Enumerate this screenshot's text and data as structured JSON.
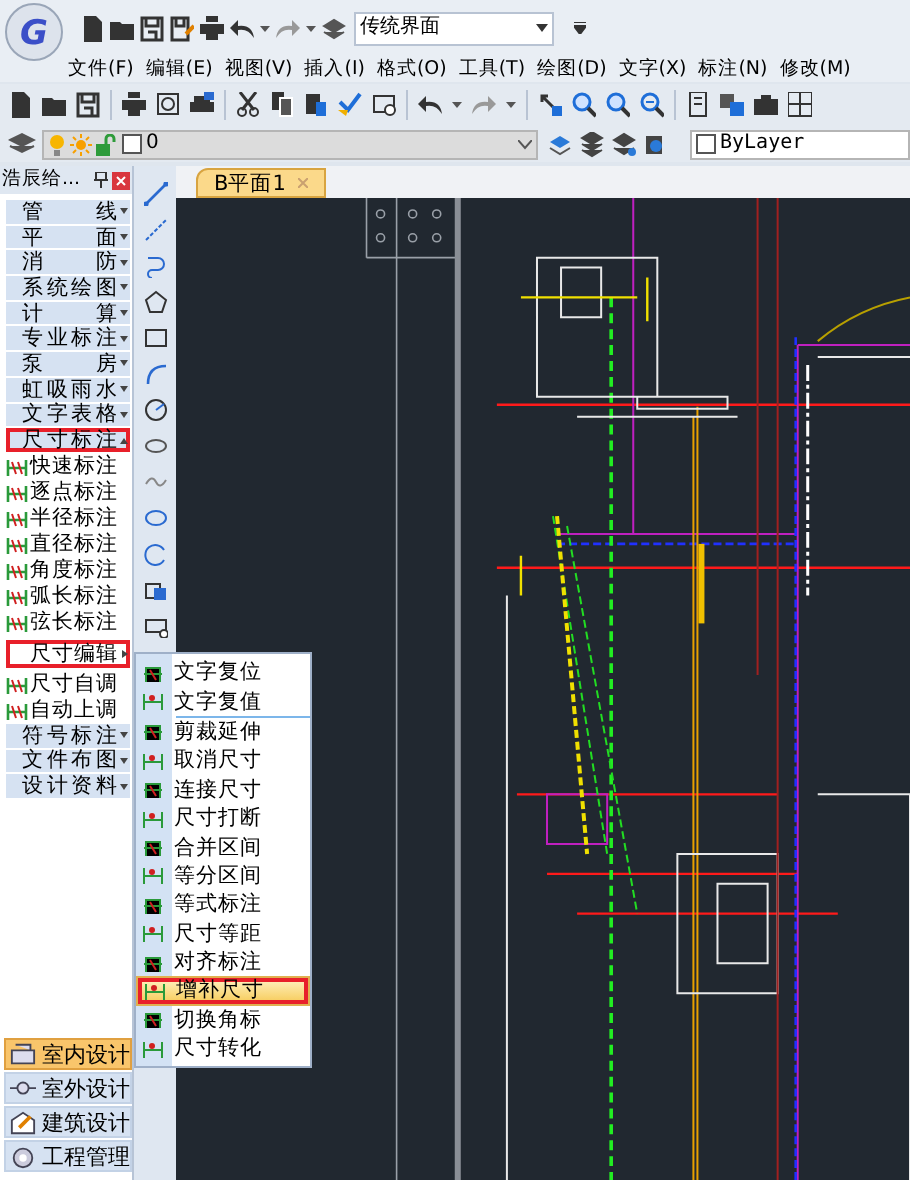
{
  "app": {
    "logo": "G"
  },
  "quick_access": {
    "workspace_dropdown": "传统界面"
  },
  "menu": [
    "文件(F)",
    "编辑(E)",
    "视图(V)",
    "插入(I)",
    "格式(O)",
    "工具(T)",
    "绘图(D)",
    "文字(X)",
    "标注(N)",
    "修改(M)"
  ],
  "layer_bar": {
    "layer": "0",
    "linetype": "ByLayer"
  },
  "panel": {
    "title": "浩辰给...",
    "items": [
      {
        "kind": "category",
        "label": "管 线",
        "expanded": false,
        "marked": false
      },
      {
        "kind": "category",
        "label": "平 面",
        "expanded": false,
        "marked": false
      },
      {
        "kind": "category",
        "label": "消 防",
        "expanded": false,
        "marked": false
      },
      {
        "kind": "category",
        "label": "系统绘图",
        "expanded": false,
        "marked": false
      },
      {
        "kind": "category",
        "label": "计 算",
        "expanded": false,
        "marked": false
      },
      {
        "kind": "category",
        "label": "专业标注",
        "expanded": false,
        "marked": false
      },
      {
        "kind": "category",
        "label": "泵 房",
        "expanded": false,
        "marked": false
      },
      {
        "kind": "category",
        "label": "虹吸雨水",
        "expanded": false,
        "marked": false
      },
      {
        "kind": "category",
        "label": "文字表格",
        "expanded": false,
        "marked": false
      },
      {
        "kind": "category",
        "label": "尺寸标注",
        "expanded": true,
        "marked": true
      },
      {
        "kind": "tool",
        "label": "快速标注",
        "marked": false
      },
      {
        "kind": "tool",
        "label": "逐点标注",
        "marked": false
      },
      {
        "kind": "tool",
        "label": "半径标注",
        "marked": false
      },
      {
        "kind": "tool",
        "label": "直径标注",
        "marked": false
      },
      {
        "kind": "tool",
        "label": "角度标注",
        "marked": false
      },
      {
        "kind": "tool",
        "label": "弧长标注",
        "marked": false
      },
      {
        "kind": "tool",
        "label": "弦长标注",
        "marked": false
      },
      {
        "kind": "flyout",
        "label": "尺寸编辑",
        "marked": true
      },
      {
        "kind": "tool",
        "label": "尺寸自调",
        "marked": false
      },
      {
        "kind": "tool",
        "label": "自动上调",
        "marked": false
      },
      {
        "kind": "category",
        "label": "符号标注",
        "expanded": false,
        "marked": false
      },
      {
        "kind": "category",
        "label": "文件布图",
        "expanded": false,
        "marked": false
      },
      {
        "kind": "category",
        "label": "设计资料",
        "expanded": false,
        "marked": false
      }
    ]
  },
  "workspaces": [
    {
      "label": "室内设计",
      "selected": true
    },
    {
      "label": "室外设计",
      "selected": false
    },
    {
      "label": "建筑设计",
      "selected": false
    },
    {
      "label": "工程管理",
      "selected": false
    }
  ],
  "doc_tabs": [
    {
      "label": "B平面1",
      "selected": true
    }
  ],
  "submenu": {
    "items": [
      {
        "label": "文字复位",
        "selected": false,
        "marked": false,
        "divider_after": false
      },
      {
        "label": "文字复值",
        "selected": false,
        "marked": false,
        "divider_after": true
      },
      {
        "label": "剪裁延伸",
        "selected": false,
        "marked": false,
        "divider_after": false
      },
      {
        "label": "取消尺寸",
        "selected": false,
        "marked": false,
        "divider_after": false
      },
      {
        "label": "连接尺寸",
        "selected": false,
        "marked": false,
        "divider_after": false
      },
      {
        "label": "尺寸打断",
        "selected": false,
        "marked": false,
        "divider_after": false
      },
      {
        "label": "合并区间",
        "selected": false,
        "marked": false,
        "divider_after": false
      },
      {
        "label": "等分区间",
        "selected": false,
        "marked": false,
        "divider_after": false
      },
      {
        "label": "等式标注",
        "selected": false,
        "marked": false,
        "divider_after": false
      },
      {
        "label": "尺寸等距",
        "selected": false,
        "marked": false,
        "divider_after": false
      },
      {
        "label": "对齐标注",
        "selected": false,
        "marked": false,
        "divider_after": false
      },
      {
        "label": "增补尺寸",
        "selected": true,
        "marked": true,
        "divider_after": false
      },
      {
        "label": "切换角标",
        "selected": false,
        "marked": false,
        "divider_after": false
      },
      {
        "label": "尺寸转化",
        "selected": false,
        "marked": false,
        "divider_after": false
      }
    ]
  }
}
